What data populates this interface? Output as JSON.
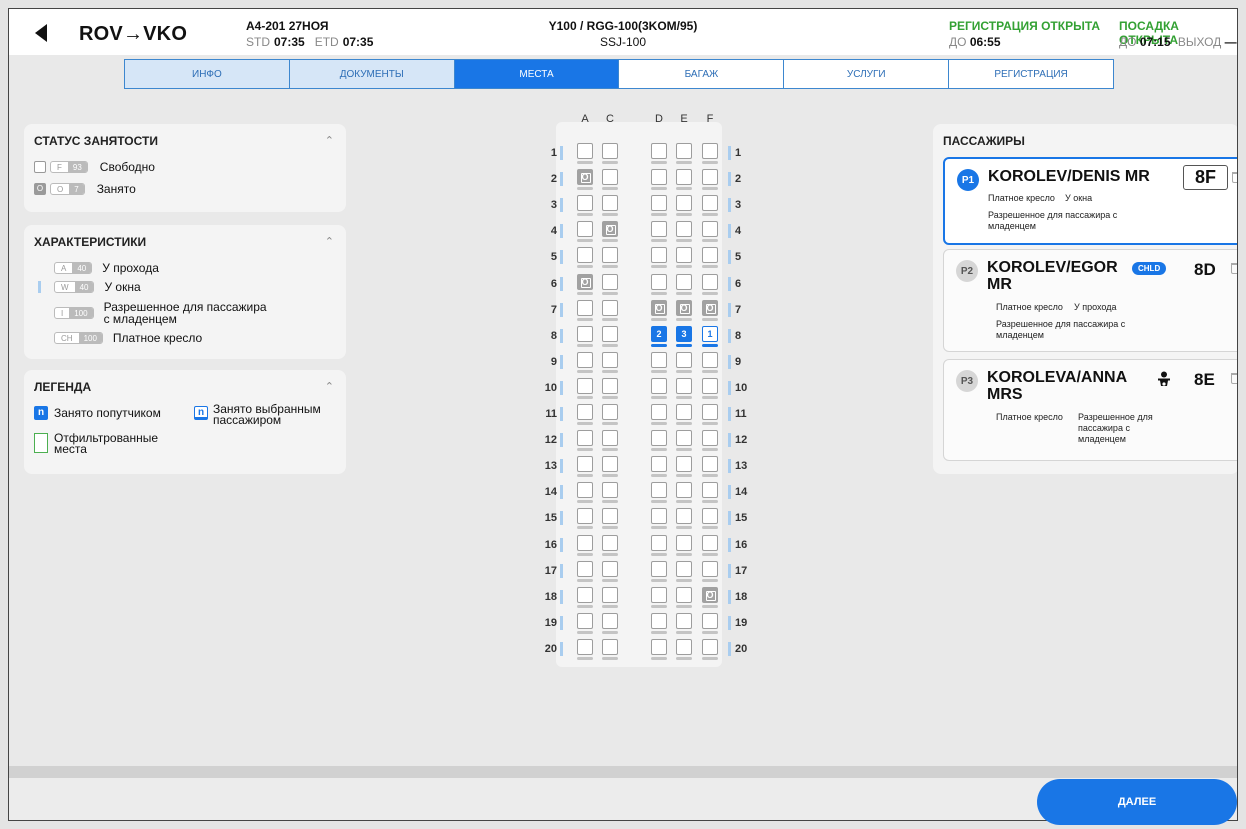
{
  "header": {
    "route": "ROV→VKO",
    "flight": "A4-201 27НОЯ",
    "std_label": "STD",
    "std": "07:35",
    "etd_label": "ETD",
    "etd": "07:35",
    "fare": "Y100 / RGG-100(3KOM/95)",
    "aircraft": "SSJ-100",
    "registration_status": "РЕГИСТРАЦИЯ ОТКРЫТА",
    "registration_until_label": "ДО",
    "registration_until": "06:55",
    "boarding_status": "ПОСАДКА ОТКРЫТА",
    "boarding_until_label": "ДО",
    "boarding_until": "07:15",
    "gate_label": "ВЫХОД",
    "gate": "—"
  },
  "tabs": [
    "ИНФО",
    "ДОКУМЕНТЫ",
    "МЕСТА",
    "БАГАЖ",
    "УСЛУГИ",
    "РЕГИСТРАЦИЯ"
  ],
  "occupancy": {
    "title": "СТАТУС ЗАНЯТОСТИ",
    "free_code": "F",
    "free_count": "93",
    "free_label": "Свободно",
    "occupied_code": "O",
    "occupied_count": "7",
    "occupied_label": "Занято"
  },
  "characteristics": {
    "title": "ХАРАКТЕРИСТИКИ",
    "items": [
      {
        "code": "A",
        "count": "40",
        "label": "У прохода"
      },
      {
        "code": "W",
        "count": "40",
        "label": "У окна"
      },
      {
        "code": "I",
        "count": "100",
        "label": "Разрешенное для пассажира с младенцем"
      },
      {
        "code": "CH",
        "count": "100",
        "label": "Платное кресло"
      }
    ]
  },
  "legend": {
    "title": "ЛЕГЕНДА",
    "companion": "Занято попутчиком",
    "selected": "Занято выбранным пассажиром",
    "filtered": "Отфильтрованные места",
    "glyph": "n"
  },
  "seatmap": {
    "columns": [
      "A",
      "C",
      "D",
      "E",
      "F"
    ],
    "rows": [
      "1",
      "2",
      "3",
      "4",
      "5",
      "6",
      "7",
      "8",
      "9",
      "10",
      "11",
      "12",
      "13",
      "14",
      "15",
      "16",
      "17",
      "18",
      "19",
      "20"
    ],
    "occupied_mark": "O",
    "occupied": [
      "2A",
      "4C",
      "6A",
      "7D",
      "7E",
      "7F",
      "18F"
    ],
    "assigned": {
      "8D": "2",
      "8E": "3",
      "8F": "1"
    }
  },
  "passengers": {
    "title": "ПАССАЖИРЫ",
    "list": [
      {
        "badge": "P1",
        "name": "KOROLEV/DENIS MR",
        "seat": "8F",
        "attr1": "Платное кресло",
        "attr2": "У окна",
        "attr3": "Разрешенное для пассажира с младенцем"
      },
      {
        "badge": "P2",
        "name": "KOROLEV/EGOR MR",
        "tag": "CHLD",
        "seat": "8D",
        "attr1": "Платное кресло",
        "attr2": "У прохода",
        "attr3": "Разрешенное для пассажира с младенцем"
      },
      {
        "badge": "P3",
        "name": "KOROLEVA/ANNA MRS",
        "seat": "8E",
        "attr1": "Платное кресло",
        "attr2": "Разрешенное для пассажира с младенцем"
      }
    ]
  },
  "next_label": "ДАЛЕЕ",
  "colors": {
    "accent": "#1976e6",
    "status_green": "#33a133",
    "occupied": "#a1a1a1"
  }
}
